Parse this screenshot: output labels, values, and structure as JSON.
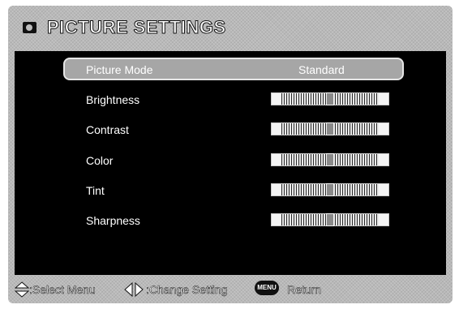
{
  "header": {
    "title": "PICTURE SETTINGS",
    "icon": "picture-icon"
  },
  "menu": {
    "selected_index": 0,
    "items": [
      {
        "label": "Picture Mode",
        "type": "value",
        "value": "Standard"
      },
      {
        "label": "Brightness",
        "type": "slider",
        "level": 0.5
      },
      {
        "label": "Contrast",
        "type": "slider",
        "level": 0.5
      },
      {
        "label": "Color",
        "type": "slider",
        "level": 0.5
      },
      {
        "label": "Tint",
        "type": "slider",
        "level": 0.5
      },
      {
        "label": "Sharpness",
        "type": "slider",
        "level": 0.5
      }
    ]
  },
  "footer": {
    "select_label": ":Select Menu",
    "change_label": ":Change Setting",
    "menu_key_label": "MENU",
    "return_label": "Return"
  }
}
